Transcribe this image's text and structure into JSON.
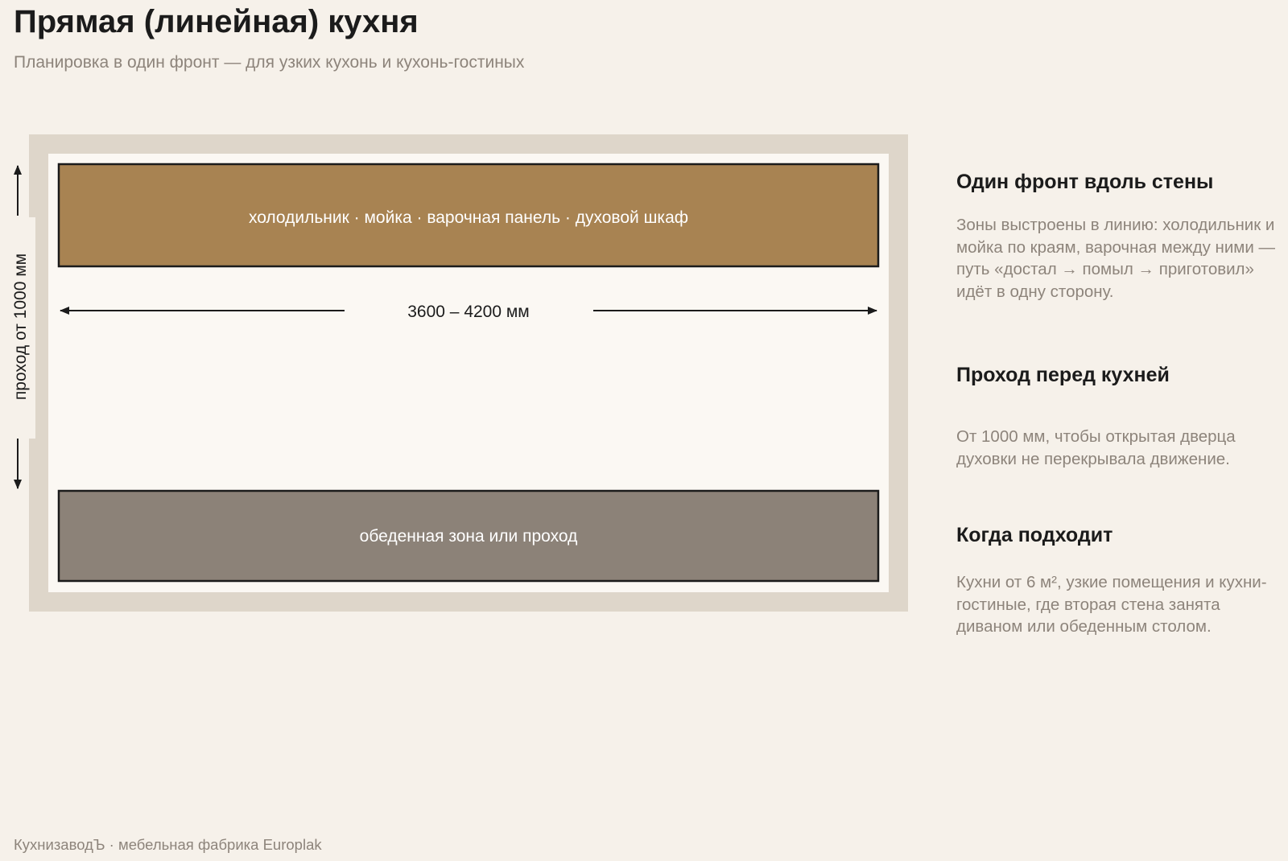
{
  "header": {
    "title": "Прямая (линейная) кухня",
    "subtitle": "Планировка в один фронт — для узких кухонь и кухонь-гостиных"
  },
  "diagram": {
    "front_label": "холодильник · мойка · варочная панель · духовой шкаф",
    "length_label": "3600 – 4200 мм",
    "passage_label": "проход от 1000 мм",
    "opposite_label": "обеденная зона или проход",
    "colors": {
      "wall": "#ded6ca",
      "floor": "#fbf8f3",
      "front": "#a88352",
      "opposite": "#8c8278",
      "outline": "#1b1b1b",
      "label": "#ffffff"
    }
  },
  "sidebar": {
    "sections": [
      {
        "heading": "Один фронт вдоль стены",
        "text": "Зоны выстроены в линию: холодильник и мойка по краям, варочная между ними — путь «достал → помыл → приготовил» идёт в одну сторону."
      },
      {
        "heading": "Проход перед кухней",
        "text": "От 1000 мм, чтобы открытая дверца духовки не перекрывала движение."
      },
      {
        "heading": "Когда подходит",
        "text": "Кухни от 6 м², узкие помещения и кухни-гостиные, где вторая стена занята диваном или обеденным столом."
      }
    ]
  },
  "footer": {
    "text": "КухнизаводЪ · мебельная фабрика Europlak"
  }
}
